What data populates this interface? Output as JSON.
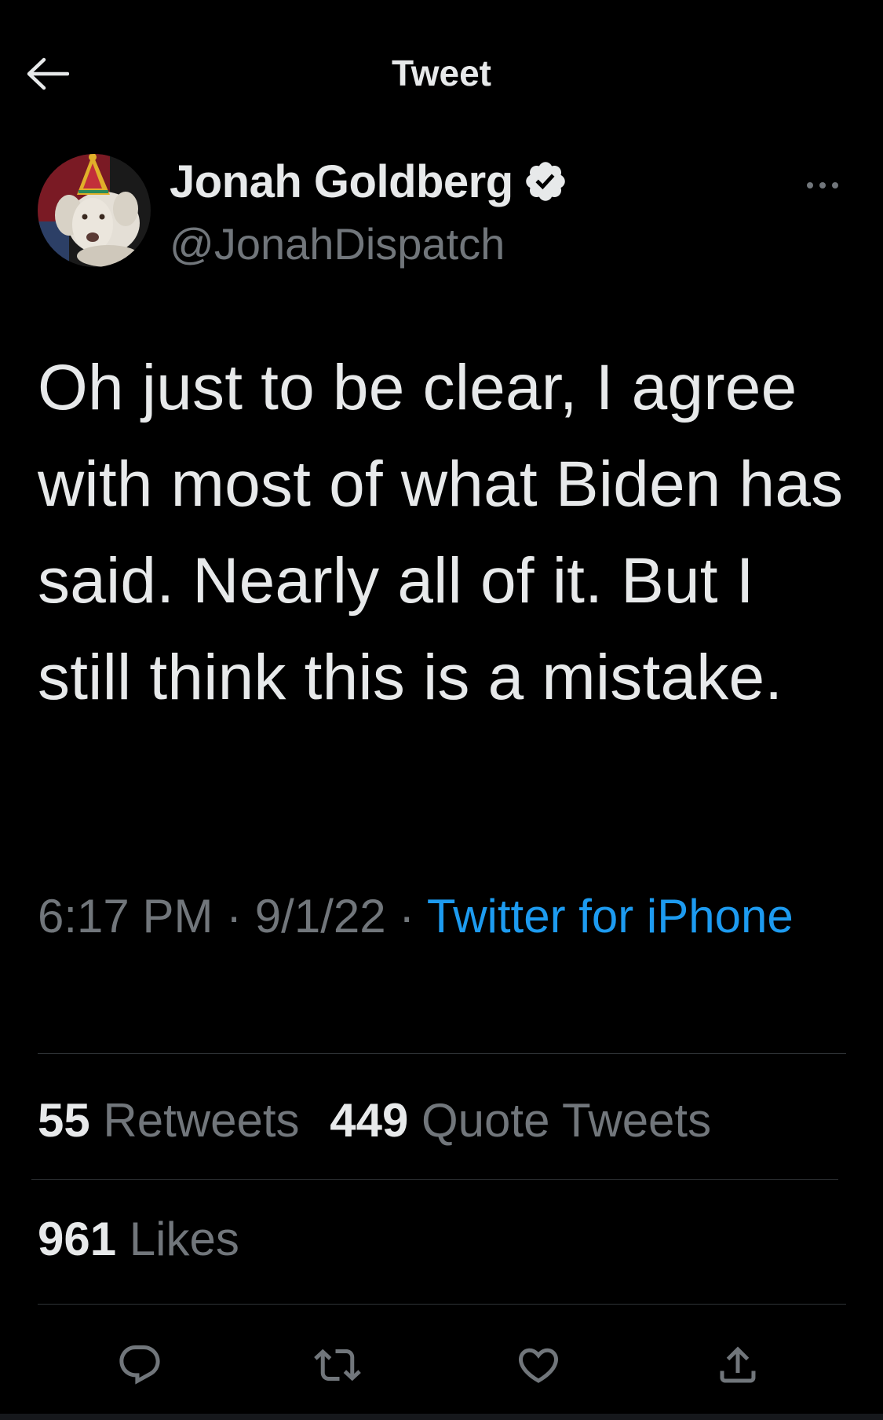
{
  "header": {
    "title": "Tweet",
    "back_icon": "arrow-left-icon"
  },
  "author": {
    "display_name": "Jonah Goldberg",
    "handle": "@JonahDispatch",
    "verified_icon": "verified-badge-icon",
    "more_icon": "more-horizontal-icon"
  },
  "tweet": {
    "text": "Oh just to be clear, I agree with most of what Biden has said. Nearly all of it. But I still think this is a mistake.",
    "time": "6:17 PM",
    "separator": "·",
    "date": "9/1/22",
    "source": "Twitter for iPhone"
  },
  "stats": {
    "retweets_count": "55",
    "retweets_label": "Retweets",
    "quotes_count": "449",
    "quotes_label": "Quote Tweets",
    "likes_count": "961",
    "likes_label": "Likes"
  },
  "actions": {
    "reply_icon": "reply-icon",
    "retweet_icon": "retweet-icon",
    "like_icon": "heart-icon",
    "share_icon": "share-icon"
  },
  "colors": {
    "background": "#000000",
    "text_primary": "#e7e9ea",
    "text_secondary": "#71767b",
    "accent": "#1d9bf0",
    "divider": "#2f3336"
  }
}
